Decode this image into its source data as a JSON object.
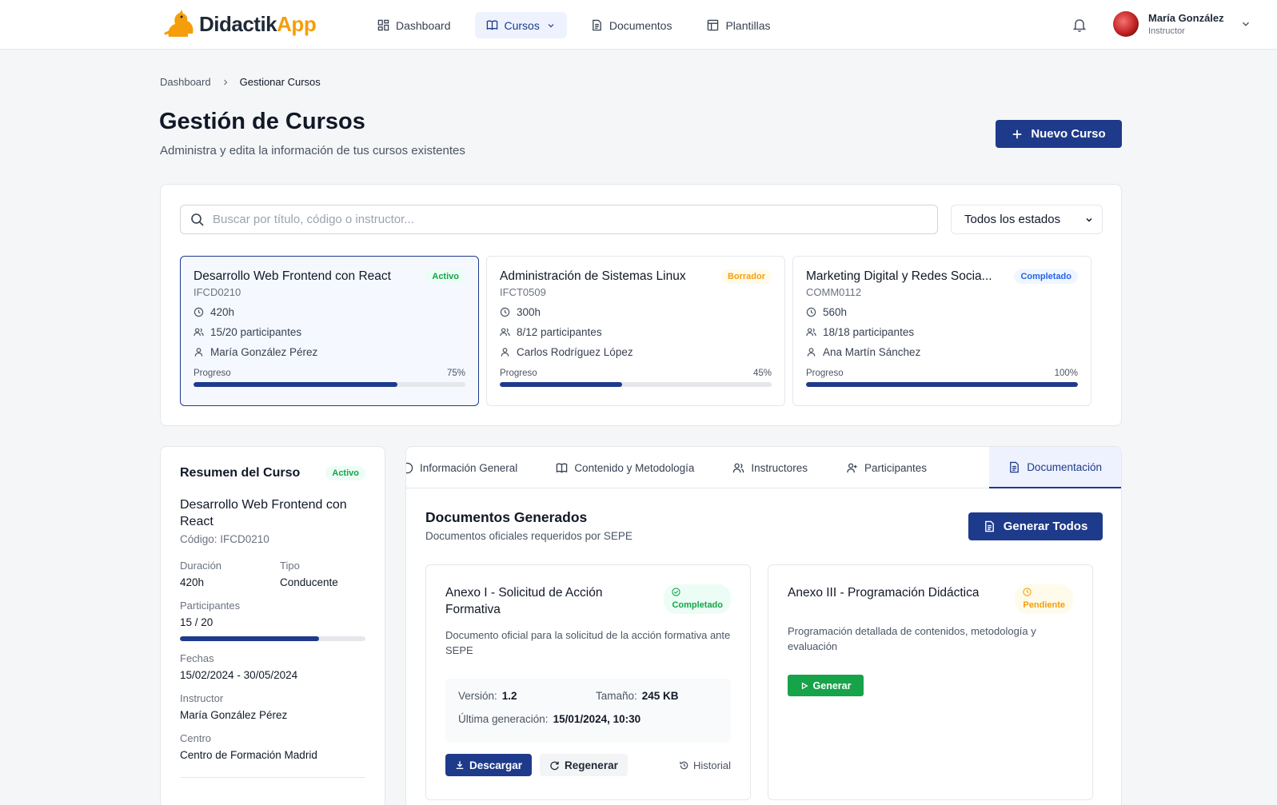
{
  "app": {
    "name_part1": "Didactik",
    "name_part2": "App",
    "brand_color": "#1e3a8a",
    "accent_color": "#f59e0b"
  },
  "nav": {
    "items": [
      {
        "label": "Dashboard",
        "icon": "dashboard-icon"
      },
      {
        "label": "Cursos",
        "icon": "book-icon",
        "active": true
      },
      {
        "label": "Documentos",
        "icon": "document-icon"
      },
      {
        "label": "Plantillas",
        "icon": "template-icon"
      }
    ]
  },
  "user": {
    "name": "María González",
    "role": "Instructor"
  },
  "breadcrumb": {
    "root": "Dashboard",
    "current": "Gestionar Cursos"
  },
  "page": {
    "title": "Gestión de Cursos",
    "subtitle": "Administra y edita la información de tus cursos existentes",
    "new_button": "Nuevo Curso"
  },
  "filters": {
    "search_placeholder": "Buscar por título, código o instructor...",
    "search_value": "",
    "status_selected": "Todos los estados"
  },
  "courses": [
    {
      "title": "Desarrollo Web Frontend con React",
      "status": "Activo",
      "code": "IFCD0210",
      "hours": "420h",
      "participants": "15/20 participantes",
      "instructor": "María González Pérez",
      "progress_label": "Progreso",
      "progress_text": "75%",
      "progress": 0.75
    },
    {
      "title": "Administración de Sistemas Linux",
      "status": "Borrador",
      "code": "IFCT0509",
      "hours": "300h",
      "participants": "8/12 participantes",
      "instructor": "Carlos Rodríguez López",
      "progress_label": "Progreso",
      "progress_text": "45%",
      "progress": 0.45
    },
    {
      "title": "Marketing Digital y Redes Socia...",
      "status": "Completado",
      "code": "COMM0112",
      "hours": "560h",
      "participants": "18/18 participantes",
      "instructor": "Ana Martín Sánchez",
      "progress_label": "Progreso",
      "progress_text": "100%",
      "progress": 1.0
    }
  ],
  "summary": {
    "title": "Resumen del Curso",
    "status": "Activo",
    "course_title": "Desarrollo Web Frontend con React",
    "code": "Código: IFCD0210",
    "duration_label": "Duración",
    "duration": "420h",
    "type_label": "Tipo",
    "type": "Conducente",
    "participants_label": "Participantes",
    "participants": "15 / 20",
    "participants_fill": 0.75,
    "dates_label": "Fechas",
    "dates": "15/02/2024 - 30/05/2024",
    "instructor_label": "Instructor",
    "instructor": "María González Pérez",
    "center_label": "Centro",
    "center": "Centro de Formación Madrid"
  },
  "tabs": [
    {
      "label": "Información General",
      "icon": "info-icon"
    },
    {
      "label": "Contenido y Metodología",
      "icon": "book-icon"
    },
    {
      "label": "Instructores",
      "icon": "users-icon"
    },
    {
      "label": "Participantes",
      "icon": "user-plus-icon"
    },
    {
      "label": "Documentación",
      "icon": "document-icon",
      "active": true
    }
  ],
  "documents": {
    "title": "Documentos Generados",
    "subtitle": "Documentos oficiales requeridos por SEPE",
    "generate_all": "Generar Todos",
    "items": [
      {
        "title": "Anexo I - Solicitud de Acción Formativa",
        "status": "Completado",
        "description": "Documento oficial para la solicitud de la acción formativa ante SEPE",
        "version_label": "Versión:",
        "version": "1.2",
        "size_label": "Tamaño:",
        "size": "245 KB",
        "last_gen_label": "Última generación:",
        "last_gen": "15/01/2024, 10:30",
        "download": "Descargar",
        "regenerate": "Regenerar",
        "history": "Historial"
      },
      {
        "title": "Anexo III - Programación Didáctica",
        "status": "Pendiente",
        "description": "Programación detallada de contenidos, metodología y evaluación",
        "generate": "Generar"
      }
    ]
  }
}
